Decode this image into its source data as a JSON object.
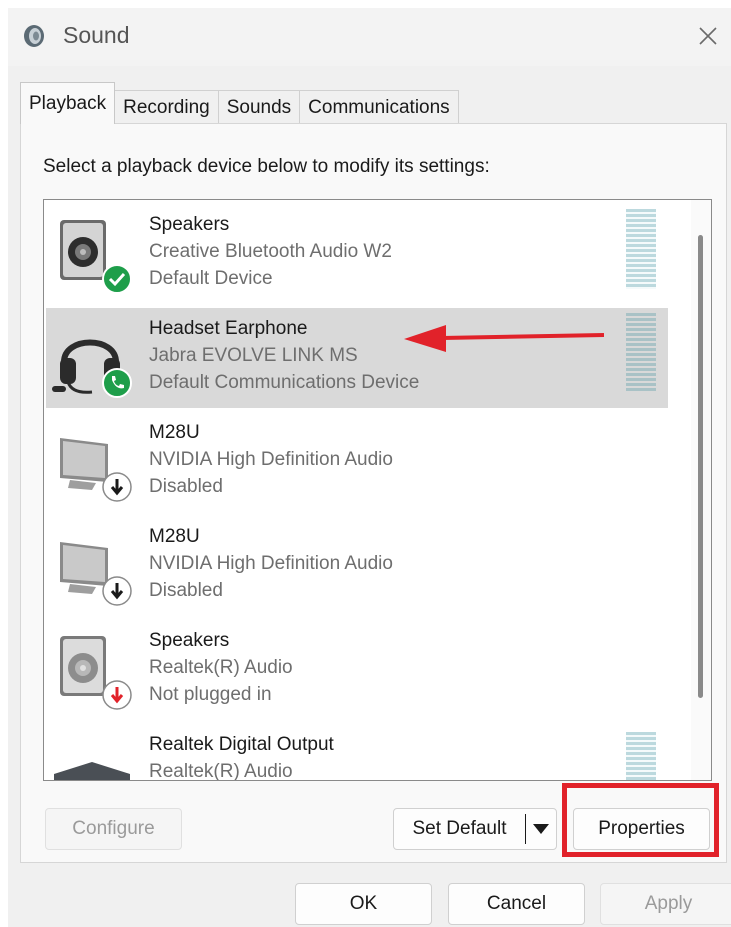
{
  "window": {
    "title": "Sound"
  },
  "tabs": [
    {
      "label": "Playback",
      "active": true
    },
    {
      "label": "Recording",
      "active": false
    },
    {
      "label": "Sounds",
      "active": false
    },
    {
      "label": "Communications",
      "active": false
    }
  ],
  "instruction": "Select a playback device below to modify its settings:",
  "devices": [
    {
      "name": "Speakers",
      "driver": "Creative Bluetooth Audio W2",
      "status": "Default Device",
      "icon": "speaker-icon",
      "badge": "default-check-badge-icon",
      "selected": false
    },
    {
      "name": "Headset Earphone",
      "driver": "Jabra EVOLVE LINK MS",
      "status": "Default Communications Device",
      "icon": "headset-icon",
      "badge": "phone-badge-icon",
      "selected": true
    },
    {
      "name": "M28U",
      "driver": "NVIDIA High Definition Audio",
      "status": "Disabled",
      "icon": "monitor-icon",
      "badge": "disabled-arrow-badge-icon",
      "selected": false
    },
    {
      "name": "M28U",
      "driver": "NVIDIA High Definition Audio",
      "status": "Disabled",
      "icon": "monitor-icon",
      "badge": "disabled-arrow-badge-icon",
      "selected": false
    },
    {
      "name": "Speakers",
      "driver": "Realtek(R) Audio",
      "status": "Not plugged in",
      "icon": "speaker-icon",
      "badge": "unplugged-badge-icon",
      "selected": false
    },
    {
      "name": "Realtek Digital Output",
      "driver": "Realtek(R) Audio",
      "status": "",
      "icon": "digital-output-icon",
      "badge": "",
      "selected": false
    }
  ],
  "buttons": {
    "configure": "Configure",
    "set_default": "Set Default",
    "properties": "Properties",
    "ok": "OK",
    "cancel": "Cancel",
    "apply": "Apply"
  },
  "colors": {
    "annotation_red": "#e1222a",
    "check_green": "#1e9e4a",
    "selection_gray": "#d9d9d9"
  }
}
